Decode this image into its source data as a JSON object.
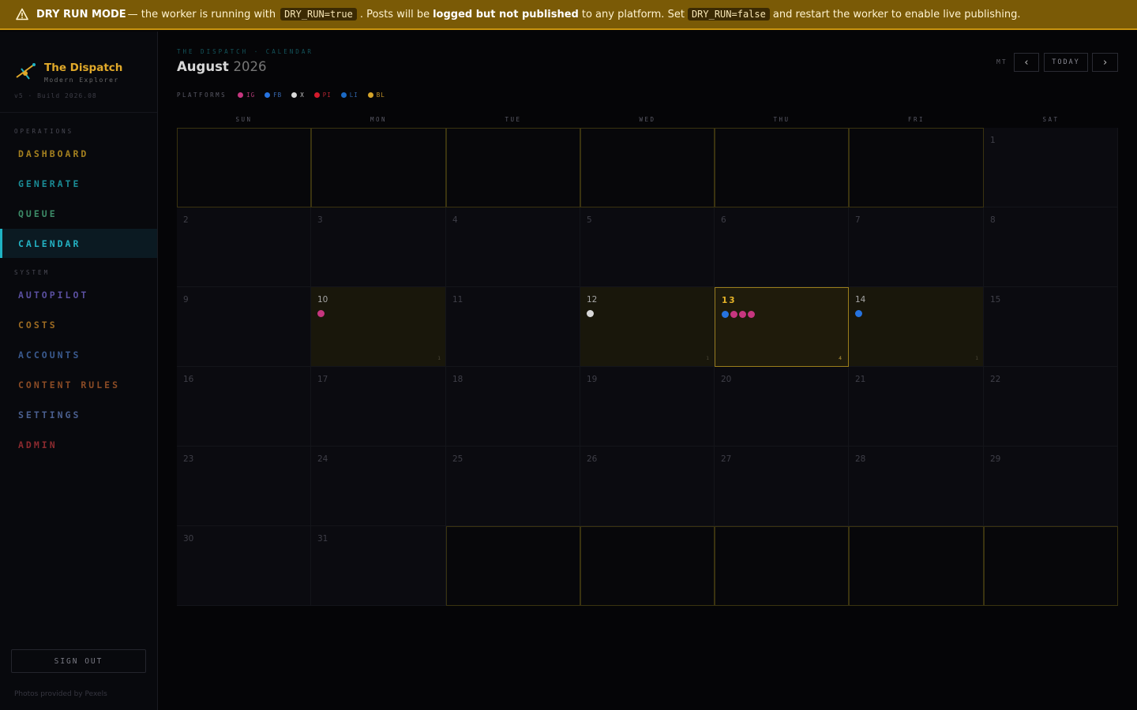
{
  "banner": {
    "title": "DRY RUN MODE",
    "text1": "— the worker is running with",
    "code1": "DRY_RUN=true",
    "text2": ". Posts will be",
    "bold2": "logged but not published",
    "text3": "to any platform. Set",
    "code2": "DRY_RUN=false",
    "text4": "and restart the worker to enable live publishing."
  },
  "sidebar": {
    "brand": "The Dispatch",
    "subtitle": "Modern Explorer",
    "version": "v5 · Build 2026.08",
    "section_ops": "OPERATIONS",
    "section_sys": "SYSTEM",
    "nav": [
      {
        "label": "DASHBOARD",
        "color": "#a4801f"
      },
      {
        "label": "GENERATE",
        "color": "#1a8b95"
      },
      {
        "label": "QUEUE",
        "color": "#3c8a67"
      },
      {
        "label": "CALENDAR",
        "color": "#23b2c3"
      },
      {
        "label": "AUTOPILOT",
        "color": "#5a4f9f"
      },
      {
        "label": "COSTS",
        "color": "#9b6a22"
      },
      {
        "label": "ACCOUNTS",
        "color": "#3a5a8f"
      },
      {
        "label": "CONTENT RULES",
        "color": "#8a4b25"
      },
      {
        "label": "SETTINGS",
        "color": "#4a5f8f"
      },
      {
        "label": "ADMIN",
        "color": "#8b2a2f"
      }
    ],
    "signout": "SIGN OUT",
    "credit": "Photos provided by Pexels"
  },
  "header": {
    "breadcrumb": "THE DISPATCH · CALENDAR",
    "month": "August",
    "year": "2026",
    "platforms_label": "PLATFORMS",
    "timezone": "MT",
    "today_label": "TODAY",
    "prev_icon": "‹",
    "next_icon": "›"
  },
  "platforms": [
    {
      "code": "IG",
      "color": "#c6367f",
      "text_color": "#b03a75"
    },
    {
      "code": "FB",
      "color": "#2673e0",
      "text_color": "#3869b0"
    },
    {
      "code": "X",
      "color": "#d8d8d8",
      "text_color": "#c8c8c8"
    },
    {
      "code": "PI",
      "color": "#d41a2b",
      "text_color": "#b0242f"
    },
    {
      "code": "LI",
      "color": "#1b69c4",
      "text_color": "#2f63a6"
    },
    {
      "code": "BL",
      "color": "#d6a52a",
      "text_color": "#c19228"
    }
  ],
  "weekdays": [
    "SUN",
    "MON",
    "TUE",
    "WED",
    "THU",
    "FRI",
    "SAT"
  ],
  "calendar": {
    "lead_blanks": 6,
    "days_in_month": 31,
    "today": 13,
    "posts": {
      "10": {
        "dots": [
          "IG"
        ],
        "count": "1"
      },
      "12": {
        "dots": [
          "X"
        ],
        "count": "1"
      },
      "13": {
        "dots": [
          "FB",
          "IG",
          "IG",
          "IG"
        ],
        "count": "4"
      },
      "14": {
        "dots": [
          "FB"
        ],
        "count": "1"
      }
    }
  }
}
